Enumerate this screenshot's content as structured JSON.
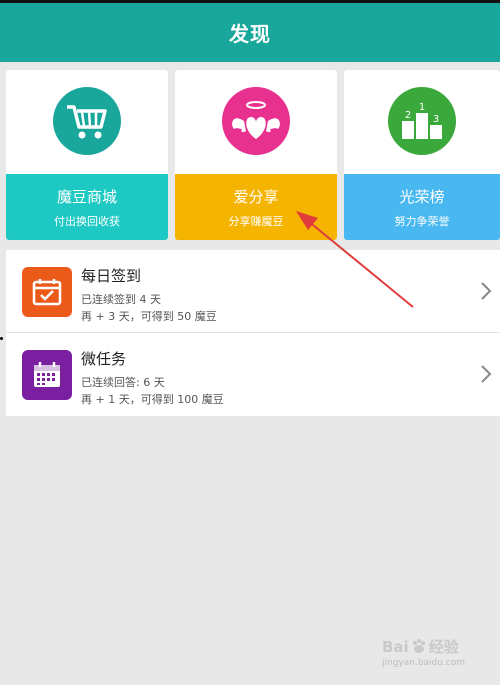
{
  "header": {
    "title": "发现"
  },
  "cards": [
    {
      "name": "魔豆商城",
      "subtitle": "付出换回收获",
      "icon": "shopping-cart-icon",
      "circle_color": "#1aa79b",
      "band_color": "#1ec9c4"
    },
    {
      "name": "爱分享",
      "subtitle": "分享赚魔豆",
      "icon": "winged-heart-icon",
      "circle_color": "#e8318e",
      "band_color": "#f5b400"
    },
    {
      "name": "光荣榜",
      "subtitle": "努力争荣誉",
      "icon": "podium-icon",
      "circle_color": "#3aa83a",
      "band_color": "#49b8f0",
      "podium": [
        "2",
        "1",
        "3"
      ]
    }
  ],
  "list": [
    {
      "title": "每日签到",
      "line1": "已连续签到 4 天",
      "line2": "再 + 3 天，可得到 50 魔豆",
      "icon": "calendar-check-icon",
      "color": "#ec5a1a"
    },
    {
      "title": "微任务",
      "line1": "已连续回答: 6 天",
      "line2": "再 + 1 天，可得到 100 魔豆",
      "icon": "calendar-grid-icon",
      "color": "#7a1fa0"
    }
  ],
  "annotation_color": "#e03c3c",
  "watermark": {
    "brand": "Bai",
    "brand2": "经验",
    "site": "jingyan.baidu.com"
  }
}
